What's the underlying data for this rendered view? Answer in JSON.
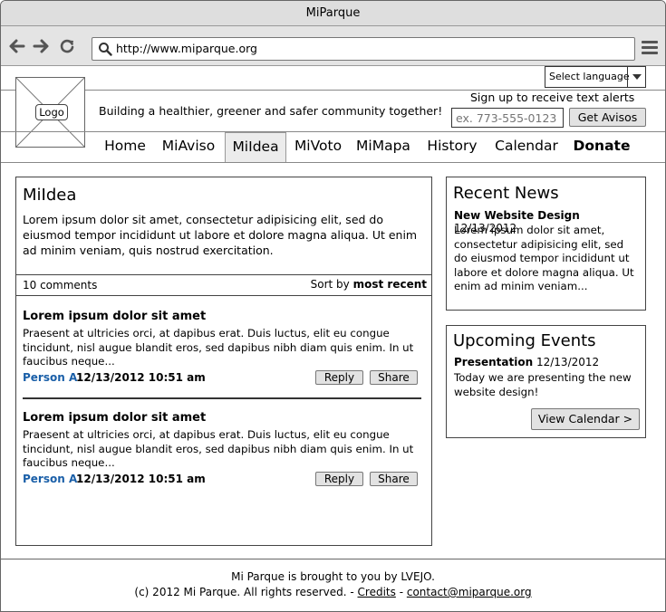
{
  "window": {
    "title": "MiParque"
  },
  "browser": {
    "url": "http://www.miparque.org",
    "icons": [
      "back-arrow-icon",
      "forward-arrow-icon",
      "reload-icon",
      "search-icon",
      "hamburger-menu-icon"
    ]
  },
  "header": {
    "language_select": "Select language",
    "logo_label": "Logo",
    "tagline": "Building a healthier, greener and safer community together!",
    "signup_label": "Sign up to receive text alerts",
    "phone_placeholder": "ex. 773-555-0123",
    "signup_button": "Get Avisos"
  },
  "nav": {
    "items": [
      {
        "label": "Home"
      },
      {
        "label": "MiAviso"
      },
      {
        "label": "MiIdea",
        "active": true
      },
      {
        "label": "MiVoto"
      },
      {
        "label": "MiMapa"
      },
      {
        "label": "History"
      },
      {
        "label": "Calendar"
      },
      {
        "label": "Donate",
        "bold": true
      }
    ]
  },
  "idea": {
    "title": "MiIdea",
    "body": "Lorem ipsum dolor sit amet, consectetur adipisicing elit, sed do eiusmod tempor incididunt ut labore et dolore magna aliqua. Ut enim ad minim veniam, quis nostrud exercitation.",
    "comments_count": "10 comments",
    "sort_prefix": "Sort by",
    "sort_value": "most recent",
    "comments": [
      {
        "title": "Lorem ipsum dolor sit amet",
        "body": "Praesent at ultricies orci, at dapibus erat. Duis luctus, elit eu congue tincidunt, nisl augue blandit eros, sed dapibus nibh diam quis enim. In ut faucibus neque...",
        "author": "Person A",
        "date": "12/13/2012 10:51 am",
        "reply": "Reply",
        "share": "Share"
      },
      {
        "title": "Lorem ipsum dolor sit amet",
        "body": "Praesent at ultricies orci, at dapibus erat. Duis luctus, elit eu congue tincidunt, nisl augue blandit eros, sed dapibus nibh diam quis enim. In ut faucibus neque...",
        "author": "Person A",
        "date": "12/13/2012 10:51 am",
        "reply": "Reply",
        "share": "Share"
      }
    ]
  },
  "news": {
    "title": "Recent News",
    "headline": "New Website Design",
    "date": "12/13/2012",
    "body": "Lorem ipsum dolor sit amet, consectetur adipisicing elit, sed do eiusmod tempor incididunt ut labore et dolore magna aliqua. Ut enim ad minim veniam..."
  },
  "events": {
    "title": "Upcoming Events",
    "headline": "Presentation",
    "date": "12/13/2012",
    "body": "Today we are presenting the new website design!",
    "button": "View Calendar >"
  },
  "footer": {
    "line1": "Mi Parque is brought to you by LVEJO.",
    "copyright": "(c) 2012 Mi Parque. All rights reserved. -",
    "credits": "Credits",
    "separator": "-",
    "contact": "contact@miparque.org"
  },
  "colors": {
    "author_link": "#1a5fa8",
    "chrome_bg": "#e4e4e4"
  }
}
